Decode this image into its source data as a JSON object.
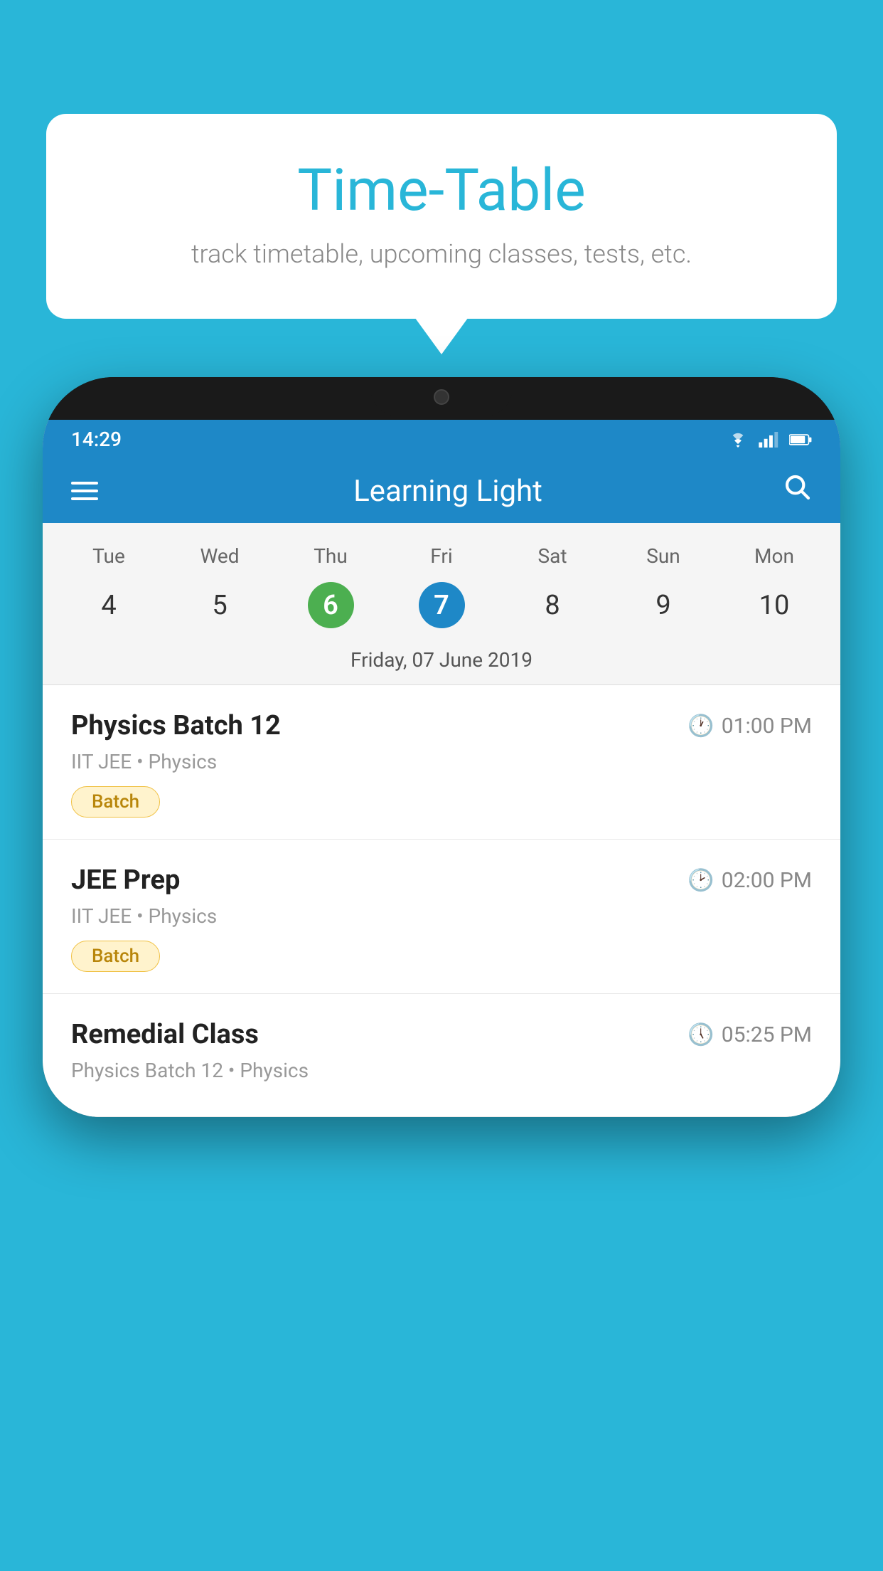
{
  "background_color": "#29B6D8",
  "bubble": {
    "title": "Time-Table",
    "subtitle": "track timetable, upcoming classes, tests, etc."
  },
  "phone": {
    "status_bar": {
      "time": "14:29"
    },
    "app_header": {
      "title": "Learning Light"
    },
    "calendar": {
      "days": [
        "Tue",
        "Wed",
        "Thu",
        "Fri",
        "Sat",
        "Sun",
        "Mon"
      ],
      "dates": [
        "4",
        "5",
        "6",
        "7",
        "8",
        "9",
        "10"
      ],
      "today_index": 2,
      "selected_index": 3,
      "selected_label": "Friday, 07 June 2019"
    },
    "schedule": [
      {
        "title": "Physics Batch 12",
        "time": "01:00 PM",
        "subtitle": "IIT JEE • Physics",
        "tag": "Batch"
      },
      {
        "title": "JEE Prep",
        "time": "02:00 PM",
        "subtitle": "IIT JEE • Physics",
        "tag": "Batch"
      },
      {
        "title": "Remedial Class",
        "time": "05:25 PM",
        "subtitle": "Physics Batch 12 • Physics",
        "tag": ""
      }
    ]
  }
}
